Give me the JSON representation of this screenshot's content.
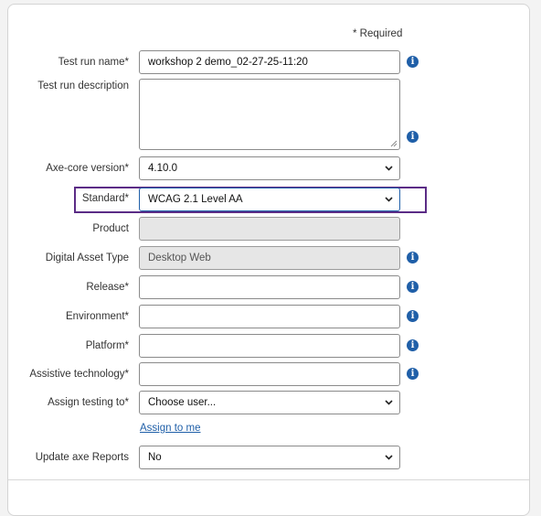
{
  "required_note": "* Required",
  "fields": {
    "test_run_name": {
      "label": "Test run name*",
      "value": "workshop 2 demo_02-27-25-11:20"
    },
    "test_run_description": {
      "label": "Test run description",
      "value": ""
    },
    "axe_core_version": {
      "label": "Axe-core version*",
      "value": "4.10.0"
    },
    "standard": {
      "label": "Standard*",
      "value": "WCAG 2.1 Level AA"
    },
    "product": {
      "label": "Product",
      "value": ""
    },
    "digital_asset_type": {
      "label": "Digital Asset Type",
      "value": "Desktop Web"
    },
    "release": {
      "label": "Release*",
      "value": ""
    },
    "environment": {
      "label": "Environment*",
      "value": ""
    },
    "platform": {
      "label": "Platform*",
      "value": ""
    },
    "assistive_technology": {
      "label": "Assistive technology*",
      "value": ""
    },
    "assign_testing_to": {
      "label": "Assign testing to*",
      "value": "Choose user..."
    },
    "update_axe_reports": {
      "label": "Update axe Reports",
      "value": "No"
    }
  },
  "assign_to_me_link": "Assign to me",
  "info_glyph": "i",
  "colors": {
    "info": "#1f5fa8",
    "highlight": "#5b2c86",
    "link": "#1f5fa8"
  },
  "icons": {
    "info": "info-circle-icon",
    "dropdown": "chevron-down-icon",
    "resize": "resize-grip-icon"
  }
}
